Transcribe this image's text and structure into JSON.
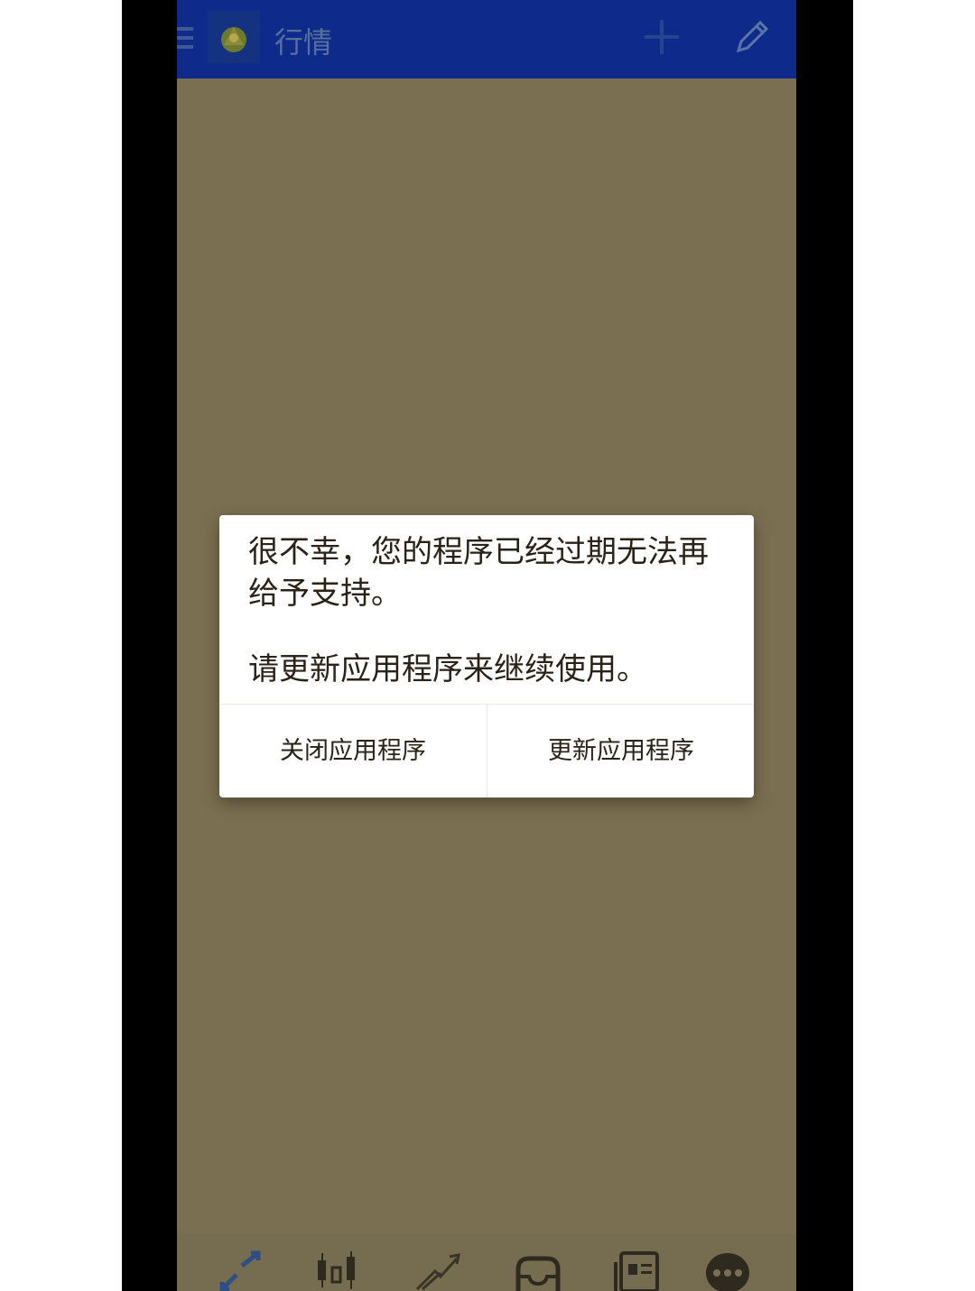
{
  "appbar": {
    "title": "行情",
    "icons": [
      "menu-icon",
      "app-logo-icon",
      "plus-icon",
      "pencil-icon"
    ]
  },
  "dialog": {
    "message_line1": "很不幸，您的程序已经过期无法再",
    "message_line2": "给予支持。",
    "message_line3": "请更新应用程序来继续使用。",
    "close_button": "关闭应用程序",
    "update_button": "更新应用程序"
  },
  "bottom_nav": {
    "items": [
      "quotes-icon",
      "chart-icon",
      "trade-icon",
      "history-icon",
      "news-icon",
      "chat-icon"
    ]
  },
  "colors": {
    "appbar": "#0e2b8c",
    "overlay": "#7a6f50",
    "dialog_background": "#ffffff",
    "dialog_text": "#2a2216"
  }
}
